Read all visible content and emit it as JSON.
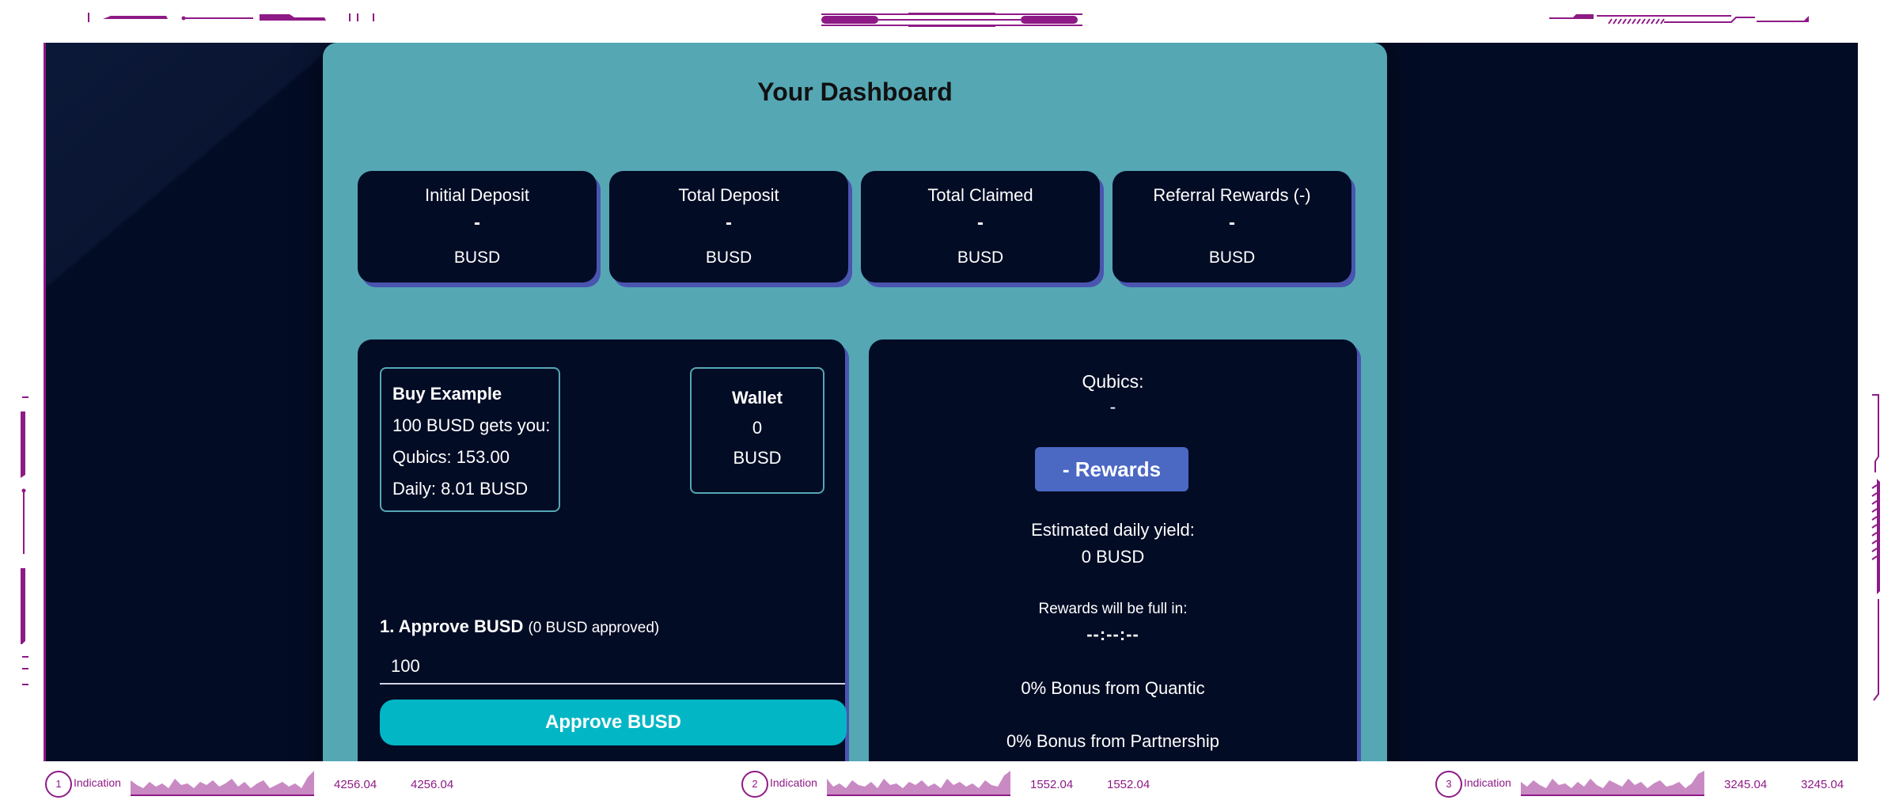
{
  "dashboard": {
    "title": "Your Dashboard",
    "stats": [
      {
        "label": "Initial Deposit",
        "value": "-",
        "unit": "BUSD"
      },
      {
        "label": "Total Deposit",
        "value": "-",
        "unit": "BUSD"
      },
      {
        "label": "Total Claimed",
        "value": "-",
        "unit": "BUSD"
      },
      {
        "label": "Referral Rewards (-)",
        "value": "-",
        "unit": "BUSD"
      }
    ]
  },
  "buy_example": {
    "title": "Buy Example",
    "line1": "100 BUSD gets you:",
    "line2": "Qubics: 153.00",
    "line3": "Daily: 8.01 BUSD"
  },
  "wallet": {
    "title": "Wallet",
    "value": "0",
    "unit": "BUSD"
  },
  "approve": {
    "label": "1. Approve BUSD",
    "sub": "(0 BUSD approved)",
    "amount": "100",
    "button": "Approve BUSD"
  },
  "rewards_panel": {
    "qubics_label": "Qubics:",
    "qubics_value": "-",
    "rewards_button": "- Rewards",
    "yield_label": "Estimated daily yield:",
    "yield_value": "0 BUSD",
    "full_label": "Rewards will be full in:",
    "full_value": "--:--:--",
    "bonus_quantic": "0% Bonus from Quantic",
    "bonus_partnership": "0% Bonus from Partnership"
  },
  "indicators": [
    {
      "num": "1",
      "label": "Indication",
      "v1": "4256.04",
      "v2": "4256.04"
    },
    {
      "num": "2",
      "label": "Indication",
      "v1": "1552.04",
      "v2": "1552.04"
    },
    {
      "num": "3",
      "label": "Indication",
      "v1": "3245.04",
      "v2": "3245.04"
    }
  ],
  "colors": {
    "frame": "#8e1a86",
    "background": "#030c25",
    "panel": "#55a7b4",
    "accent_button": "#02b6c5",
    "rewards_button": "#4b68c3"
  }
}
